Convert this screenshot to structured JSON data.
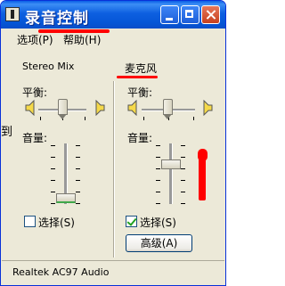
{
  "window": {
    "title": "录音控制"
  },
  "menu": {
    "options": "选项(P)",
    "help": "帮助(H)"
  },
  "columns": [
    {
      "name": "Stereo Mix",
      "balance_label": "平衡:",
      "volume_label": "音量:",
      "select_label": "选择(S)",
      "selected": false,
      "balance": 0.5,
      "volume": 0.1
    },
    {
      "name": "麦克风",
      "balance_label": "平衡:",
      "volume_label": "音量:",
      "select_label": "选择(S)",
      "selected": true,
      "balance": 0.5,
      "volume": 0.65,
      "advanced_label": "高级(A)"
    }
  ],
  "status": {
    "device": "Realtek AC97 Audio"
  },
  "cropped_left_text": "到",
  "annotation_color": "#ff0000"
}
